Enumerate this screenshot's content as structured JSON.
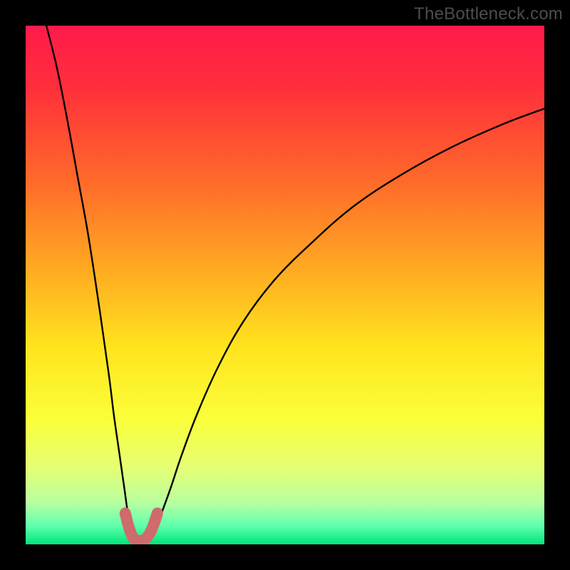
{
  "watermark": "TheBottleneck.com",
  "chart_data": {
    "type": "line",
    "title": "",
    "xlabel": "",
    "ylabel": "",
    "xlim": [
      0,
      100
    ],
    "ylim": [
      0,
      100
    ],
    "grid": false,
    "gradient_stops": [
      {
        "pos": 0.0,
        "color": "#ff1a4b"
      },
      {
        "pos": 0.12,
        "color": "#ff2f3b"
      },
      {
        "pos": 0.3,
        "color": "#ff6a2a"
      },
      {
        "pos": 0.48,
        "color": "#ffae21"
      },
      {
        "pos": 0.62,
        "color": "#ffe41e"
      },
      {
        "pos": 0.76,
        "color": "#faff3a"
      },
      {
        "pos": 0.85,
        "color": "#e6ff73"
      },
      {
        "pos": 0.92,
        "color": "#b8ffa0"
      },
      {
        "pos": 0.965,
        "color": "#5dffad"
      },
      {
        "pos": 1.0,
        "color": "#00e67a"
      }
    ],
    "curve_left": {
      "note": "steep descending arc from top-left to the notch near x≈21",
      "x": [
        4,
        6,
        8,
        10,
        12,
        14,
        16,
        17,
        18,
        19,
        19.7,
        20.3,
        20.8
      ],
      "y": [
        100,
        92,
        82,
        71,
        60,
        47,
        33,
        25,
        18,
        11,
        6,
        3,
        1.5
      ]
    },
    "curve_right": {
      "note": "rising arc from the notch toward top-right, asymptotically flattening",
      "x": [
        24.2,
        25,
        26,
        28,
        30,
        33,
        37,
        42,
        48,
        55,
        63,
        72,
        82,
        92,
        100
      ],
      "y": [
        1.5,
        3,
        5.5,
        11,
        17,
        25,
        34,
        43,
        51,
        58,
        65,
        71,
        76.5,
        81,
        84
      ]
    },
    "notch": {
      "note": "thick U-shaped pink marker at the curve minimum",
      "color": "#cf6b6b",
      "stroke_width": 16,
      "x": [
        19.2,
        19.8,
        20.4,
        21.0,
        21.6,
        22.2,
        23.0,
        23.8,
        24.6,
        25.4
      ],
      "y": [
        6.0,
        3.6,
        1.9,
        1.0,
        0.7,
        0.7,
        1.0,
        1.9,
        3.6,
        6.0
      ]
    }
  }
}
